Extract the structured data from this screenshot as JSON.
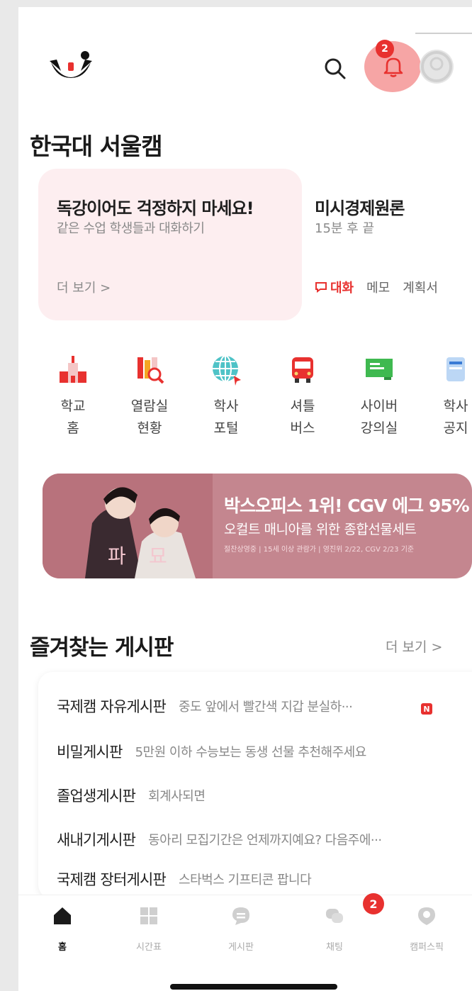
{
  "header": {
    "campus_name": "한국대 서울캠",
    "notification_count": "2"
  },
  "promo_card": {
    "title": "독강이어도 걱정하지 마세요!",
    "subtitle": "같은 수업 학생들과 대화하기",
    "more_label": "더 보기 >"
  },
  "class_card": {
    "title": "미시경제원론",
    "subtitle": "15분 후 끝",
    "actions": [
      "대화",
      "메모",
      "계획서"
    ]
  },
  "quick_menu": [
    {
      "label": "학교\n홈",
      "icon": "school-icon"
    },
    {
      "label": "열람실\n현황",
      "icon": "library-icon"
    },
    {
      "label": "학사\n포털",
      "icon": "globe-icon"
    },
    {
      "label": "셔틀\n버스",
      "icon": "bus-icon"
    },
    {
      "label": "사이버\n강의실",
      "icon": "classroom-icon"
    },
    {
      "label": "학사\n공지",
      "icon": "notice-icon"
    }
  ],
  "banner": {
    "title": "박스오피스 1위! CGV 에그 95%",
    "subtitle": "오컬트 매니아를 위한 종합선물세트",
    "note": "절찬상영중 | 15세 이상 관람가 | 영진위 2/22, CGV 2/23 기준",
    "poster_text": "파묘"
  },
  "favorites": {
    "title": "즐겨찾는 게시판",
    "more_label": "더 보기 >",
    "boards": [
      {
        "name": "국제캠 자유게시판",
        "preview": "중도 앞에서 빨간색 지갑 분실하···",
        "new": "N"
      },
      {
        "name": "비밀게시판",
        "preview": "5만원 이하 수능보는 동생 선물 추천해주세요"
      },
      {
        "name": "졸업생게시판",
        "preview": "회계사되면"
      },
      {
        "name": "새내기게시판",
        "preview": "동아리 모집기간은 언제까지예요? 다음주에···"
      },
      {
        "name": "국제캠 장터게시판",
        "preview": "스타벅스 기프티콘 팝니다"
      }
    ]
  },
  "tabbar": {
    "tabs": [
      {
        "label": "홈",
        "icon": "home-icon",
        "active": true
      },
      {
        "label": "시간표",
        "icon": "timetable-icon"
      },
      {
        "label": "게시판",
        "icon": "board-icon"
      },
      {
        "label": "채팅",
        "icon": "chat-icon",
        "badge": "2"
      },
      {
        "label": "캠퍼스픽",
        "icon": "campuspick-icon"
      }
    ]
  },
  "colors": {
    "accent": "#e8312f",
    "promo_bg": "#fdeef0",
    "banner_bg": "#c4868f",
    "bell_highlight": "#f6a5a5"
  }
}
